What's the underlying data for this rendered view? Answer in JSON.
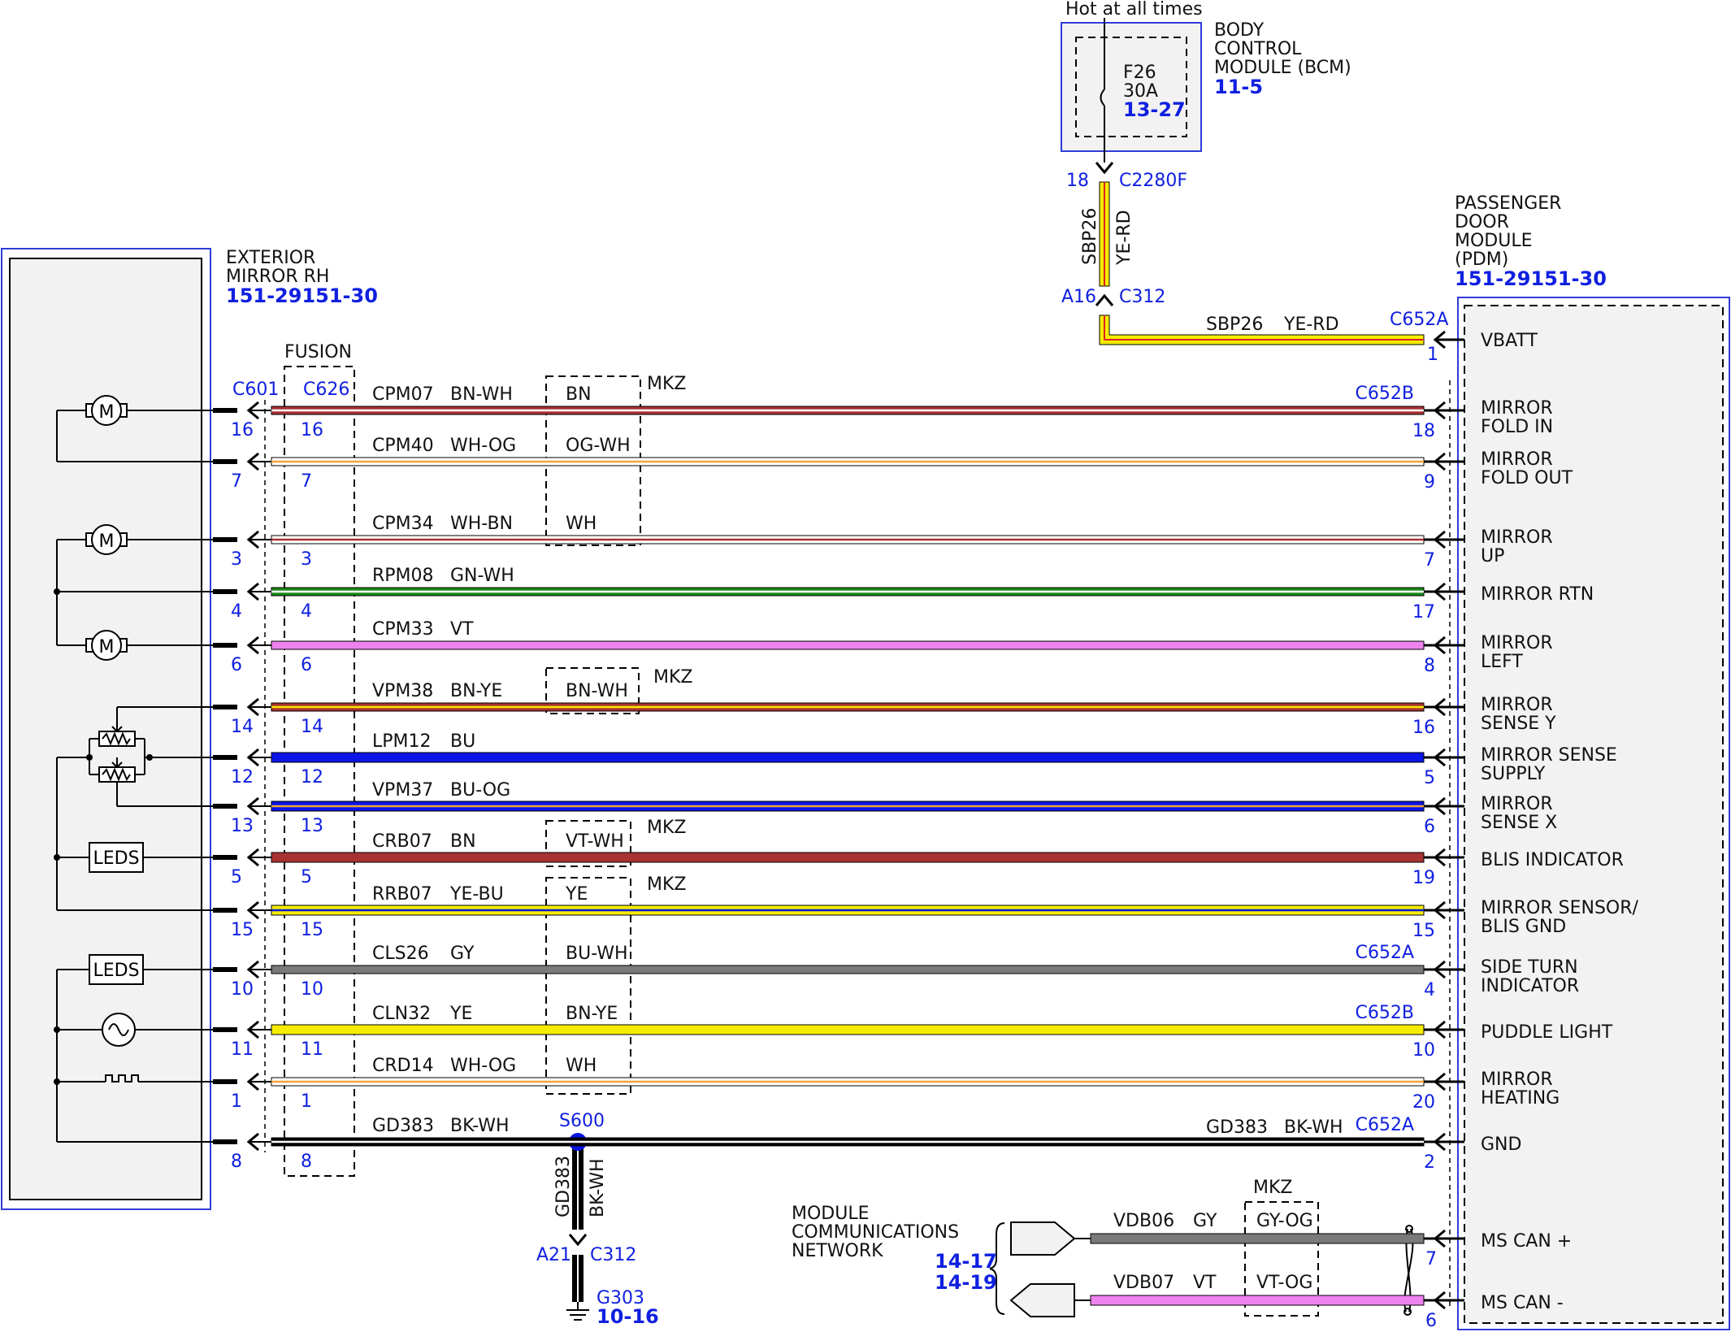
{
  "colors": {
    "module_border": "#2f3cd8",
    "ref_blue": "#1020e0",
    "module_fill": "#f2f2f2",
    "BN": "#a83232",
    "WH": "#ffffff",
    "OG": "#f2a33a",
    "GN": "#1a8a1a",
    "VT": "#ee82ee",
    "BU": "#0a14e6",
    "YE": "#f5ec00",
    "GY": "#7a7a7a",
    "BK": "#000000",
    "RD": "#e02020",
    "splice": "#0a14e6"
  },
  "bcm": {
    "hot_label": "Hot at all times",
    "title_lines": [
      "BODY",
      "CONTROL",
      "MODULE (BCM)"
    ],
    "ref": "11-5",
    "fuse_name": "F26",
    "fuse_rating": "30A",
    "fuse_ref": "13-27",
    "pin": "18",
    "connector": "C2280F"
  },
  "feed": {
    "circuit": "SBP26",
    "color_code": "YE-RD",
    "inline_pin": "A16",
    "inline_connector": "C312"
  },
  "mirror": {
    "title_lines": [
      "EXTERIOR",
      "MIRROR RH"
    ],
    "ref": "151-29151-30",
    "connector": "C601",
    "components": {
      "motor": "M",
      "leds_1": "LEDS",
      "leds_2": "LEDS"
    }
  },
  "fusion": {
    "label": "FUSION",
    "connector": "C626"
  },
  "mkz_label": "MKZ",
  "pdm": {
    "title_lines": [
      "PASSENGER",
      "DOOR",
      "MODULE",
      "(PDM)"
    ],
    "ref": "151-29151-30"
  },
  "vbatt_row": {
    "circuit": "SBP26",
    "color_code": "YE-RD",
    "connector": "C652A",
    "pin": "1",
    "function": [
      "VBATT"
    ]
  },
  "circuits": [
    {
      "mirror_pin": "16",
      "fusion_pin": "16",
      "circuit": "CPM07",
      "color_code": "BN-WH",
      "mkz_code": "BN",
      "connector": "C652B",
      "pdm_pin": "18",
      "function": [
        "MIRROR",
        "FOLD IN"
      ],
      "base": "BN",
      "stripe": "WH"
    },
    {
      "mirror_pin": "7",
      "fusion_pin": "7",
      "circuit": "CPM40",
      "color_code": "WH-OG",
      "mkz_code": "OG-WH",
      "connector": "",
      "pdm_pin": "9",
      "function": [
        "MIRROR",
        "FOLD OUT"
      ],
      "base": "WH",
      "stripe": "OG"
    },
    {
      "mirror_pin": "3",
      "fusion_pin": "3",
      "circuit": "CPM34",
      "color_code": "WH-BN",
      "mkz_code": "WH",
      "connector": "",
      "pdm_pin": "7",
      "function": [
        "MIRROR",
        "UP"
      ],
      "base": "WH",
      "stripe": "BN"
    },
    {
      "mirror_pin": "4",
      "fusion_pin": "4",
      "circuit": "RPM08",
      "color_code": "GN-WH",
      "mkz_code": "",
      "connector": "",
      "pdm_pin": "17",
      "function": [
        "MIRROR RTN"
      ],
      "base": "GN",
      "stripe": "WH"
    },
    {
      "mirror_pin": "6",
      "fusion_pin": "6",
      "circuit": "CPM33",
      "color_code": "VT",
      "mkz_code": "",
      "connector": "",
      "pdm_pin": "8",
      "function": [
        "MIRROR",
        "LEFT"
      ],
      "base": "VT",
      "stripe": ""
    },
    {
      "mirror_pin": "14",
      "fusion_pin": "14",
      "circuit": "VPM38",
      "color_code": "BN-YE",
      "mkz_code": "BN-WH",
      "connector": "",
      "pdm_pin": "16",
      "function": [
        "MIRROR",
        "SENSE Y"
      ],
      "base": "BN",
      "stripe": "YE"
    },
    {
      "mirror_pin": "12",
      "fusion_pin": "12",
      "circuit": "LPM12",
      "color_code": "BU",
      "mkz_code": "",
      "connector": "",
      "pdm_pin": "5",
      "function": [
        "MIRROR SENSE",
        "SUPPLY"
      ],
      "base": "BU",
      "stripe": ""
    },
    {
      "mirror_pin": "13",
      "fusion_pin": "13",
      "circuit": "VPM37",
      "color_code": "BU-OG",
      "mkz_code": "",
      "connector": "",
      "pdm_pin": "6",
      "function": [
        "MIRROR",
        "SENSE X"
      ],
      "base": "BU",
      "stripe": "OG"
    },
    {
      "mirror_pin": "5",
      "fusion_pin": "5",
      "circuit": "CRB07",
      "color_code": "BN",
      "mkz_code": "VT-WH",
      "connector": "",
      "pdm_pin": "19",
      "function": [
        "BLIS INDICATOR"
      ],
      "base": "BN",
      "stripe": ""
    },
    {
      "mirror_pin": "15",
      "fusion_pin": "15",
      "circuit": "RRB07",
      "color_code": "YE-BU",
      "mkz_code": "YE",
      "connector": "",
      "pdm_pin": "15",
      "function": [
        "MIRROR SENSOR/",
        "BLIS GND"
      ],
      "base": "YE",
      "stripe": "BU"
    },
    {
      "mirror_pin": "10",
      "fusion_pin": "10",
      "circuit": "CLS26",
      "color_code": "GY",
      "mkz_code": "BU-WH",
      "connector": "C652A",
      "pdm_pin": "4",
      "function": [
        "SIDE TURN",
        "INDICATOR"
      ],
      "base": "GY",
      "stripe": ""
    },
    {
      "mirror_pin": "11",
      "fusion_pin": "11",
      "circuit": "CLN32",
      "color_code": "YE",
      "mkz_code": "BN-YE",
      "connector": "C652B",
      "pdm_pin": "10",
      "function": [
        "PUDDLE LIGHT"
      ],
      "base": "YE",
      "stripe": ""
    },
    {
      "mirror_pin": "1",
      "fusion_pin": "1",
      "circuit": "CRD14",
      "color_code": "WH-OG",
      "mkz_code": "WH",
      "connector": "",
      "pdm_pin": "20",
      "function": [
        "MIRROR",
        "HEATING"
      ],
      "base": "WH",
      "stripe": "OG"
    },
    {
      "mirror_pin": "8",
      "fusion_pin": "8",
      "circuit": "GD383",
      "color_code": "BK-WH",
      "mkz_code": "",
      "connector": "C652A",
      "pdm_pin": "2",
      "function": [
        "GND"
      ],
      "base": "BK",
      "stripe": "WH"
    }
  ],
  "gnd_right_label": {
    "circuit": "GD383",
    "color_code": "BK-WH"
  },
  "splice": {
    "name": "S600",
    "drop_circuit": "GD383",
    "drop_color": "BK-WH",
    "inline_pin": "A21",
    "inline_connector": "C312",
    "ground": "G303",
    "ground_ref": "10-16"
  },
  "network": {
    "title_lines": [
      "MODULE",
      "COMMUNICATIONS",
      "NETWORK"
    ],
    "refs": [
      "14-17",
      "14-19"
    ],
    "mkz_label": "MKZ",
    "lines": [
      {
        "circuit": "VDB06",
        "color_code": "GY",
        "mkz_code": "GY-OG",
        "pdm_pin": "7",
        "function": "MS CAN +",
        "base": "GY"
      },
      {
        "circuit": "VDB07",
        "color_code": "VT",
        "mkz_code": "VT-OG",
        "pdm_pin": "6",
        "function": "MS CAN -",
        "base": "VT"
      }
    ]
  }
}
